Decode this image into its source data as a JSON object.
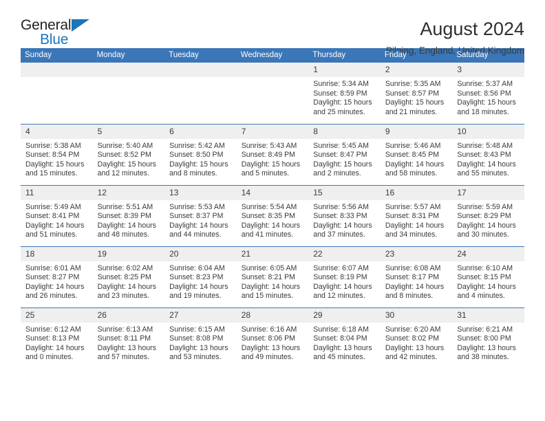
{
  "logo": {
    "primary_text": "General",
    "secondary_text": "Blue",
    "triangle_color": "#1b75bb",
    "primary_color": "#231f20",
    "secondary_color": "#1b75bb"
  },
  "header": {
    "title": "August 2024",
    "subtitle": "Pilning, England, United Kingdom"
  },
  "theme": {
    "header_blue": "#3a76b8",
    "daynum_gray": "#efefef",
    "text_color": "#3a3a3a"
  },
  "weekdays": [
    "Sunday",
    "Monday",
    "Tuesday",
    "Wednesday",
    "Thursday",
    "Friday",
    "Saturday"
  ],
  "weeks": [
    [
      {
        "day": "",
        "lines": []
      },
      {
        "day": "",
        "lines": []
      },
      {
        "day": "",
        "lines": []
      },
      {
        "day": "",
        "lines": []
      },
      {
        "day": "1",
        "lines": [
          "Sunrise: 5:34 AM",
          "Sunset: 8:59 PM",
          "Daylight: 15 hours",
          "and 25 minutes."
        ]
      },
      {
        "day": "2",
        "lines": [
          "Sunrise: 5:35 AM",
          "Sunset: 8:57 PM",
          "Daylight: 15 hours",
          "and 21 minutes."
        ]
      },
      {
        "day": "3",
        "lines": [
          "Sunrise: 5:37 AM",
          "Sunset: 8:56 PM",
          "Daylight: 15 hours",
          "and 18 minutes."
        ]
      }
    ],
    [
      {
        "day": "4",
        "lines": [
          "Sunrise: 5:38 AM",
          "Sunset: 8:54 PM",
          "Daylight: 15 hours",
          "and 15 minutes."
        ]
      },
      {
        "day": "5",
        "lines": [
          "Sunrise: 5:40 AM",
          "Sunset: 8:52 PM",
          "Daylight: 15 hours",
          "and 12 minutes."
        ]
      },
      {
        "day": "6",
        "lines": [
          "Sunrise: 5:42 AM",
          "Sunset: 8:50 PM",
          "Daylight: 15 hours",
          "and 8 minutes."
        ]
      },
      {
        "day": "7",
        "lines": [
          "Sunrise: 5:43 AM",
          "Sunset: 8:49 PM",
          "Daylight: 15 hours",
          "and 5 minutes."
        ]
      },
      {
        "day": "8",
        "lines": [
          "Sunrise: 5:45 AM",
          "Sunset: 8:47 PM",
          "Daylight: 15 hours",
          "and 2 minutes."
        ]
      },
      {
        "day": "9",
        "lines": [
          "Sunrise: 5:46 AM",
          "Sunset: 8:45 PM",
          "Daylight: 14 hours",
          "and 58 minutes."
        ]
      },
      {
        "day": "10",
        "lines": [
          "Sunrise: 5:48 AM",
          "Sunset: 8:43 PM",
          "Daylight: 14 hours",
          "and 55 minutes."
        ]
      }
    ],
    [
      {
        "day": "11",
        "lines": [
          "Sunrise: 5:49 AM",
          "Sunset: 8:41 PM",
          "Daylight: 14 hours",
          "and 51 minutes."
        ]
      },
      {
        "day": "12",
        "lines": [
          "Sunrise: 5:51 AM",
          "Sunset: 8:39 PM",
          "Daylight: 14 hours",
          "and 48 minutes."
        ]
      },
      {
        "day": "13",
        "lines": [
          "Sunrise: 5:53 AM",
          "Sunset: 8:37 PM",
          "Daylight: 14 hours",
          "and 44 minutes."
        ]
      },
      {
        "day": "14",
        "lines": [
          "Sunrise: 5:54 AM",
          "Sunset: 8:35 PM",
          "Daylight: 14 hours",
          "and 41 minutes."
        ]
      },
      {
        "day": "15",
        "lines": [
          "Sunrise: 5:56 AM",
          "Sunset: 8:33 PM",
          "Daylight: 14 hours",
          "and 37 minutes."
        ]
      },
      {
        "day": "16",
        "lines": [
          "Sunrise: 5:57 AM",
          "Sunset: 8:31 PM",
          "Daylight: 14 hours",
          "and 34 minutes."
        ]
      },
      {
        "day": "17",
        "lines": [
          "Sunrise: 5:59 AM",
          "Sunset: 8:29 PM",
          "Daylight: 14 hours",
          "and 30 minutes."
        ]
      }
    ],
    [
      {
        "day": "18",
        "lines": [
          "Sunrise: 6:01 AM",
          "Sunset: 8:27 PM",
          "Daylight: 14 hours",
          "and 26 minutes."
        ]
      },
      {
        "day": "19",
        "lines": [
          "Sunrise: 6:02 AM",
          "Sunset: 8:25 PM",
          "Daylight: 14 hours",
          "and 23 minutes."
        ]
      },
      {
        "day": "20",
        "lines": [
          "Sunrise: 6:04 AM",
          "Sunset: 8:23 PM",
          "Daylight: 14 hours",
          "and 19 minutes."
        ]
      },
      {
        "day": "21",
        "lines": [
          "Sunrise: 6:05 AM",
          "Sunset: 8:21 PM",
          "Daylight: 14 hours",
          "and 15 minutes."
        ]
      },
      {
        "day": "22",
        "lines": [
          "Sunrise: 6:07 AM",
          "Sunset: 8:19 PM",
          "Daylight: 14 hours",
          "and 12 minutes."
        ]
      },
      {
        "day": "23",
        "lines": [
          "Sunrise: 6:08 AM",
          "Sunset: 8:17 PM",
          "Daylight: 14 hours",
          "and 8 minutes."
        ]
      },
      {
        "day": "24",
        "lines": [
          "Sunrise: 6:10 AM",
          "Sunset: 8:15 PM",
          "Daylight: 14 hours",
          "and 4 minutes."
        ]
      }
    ],
    [
      {
        "day": "25",
        "lines": [
          "Sunrise: 6:12 AM",
          "Sunset: 8:13 PM",
          "Daylight: 14 hours",
          "and 0 minutes."
        ]
      },
      {
        "day": "26",
        "lines": [
          "Sunrise: 6:13 AM",
          "Sunset: 8:11 PM",
          "Daylight: 13 hours",
          "and 57 minutes."
        ]
      },
      {
        "day": "27",
        "lines": [
          "Sunrise: 6:15 AM",
          "Sunset: 8:08 PM",
          "Daylight: 13 hours",
          "and 53 minutes."
        ]
      },
      {
        "day": "28",
        "lines": [
          "Sunrise: 6:16 AM",
          "Sunset: 8:06 PM",
          "Daylight: 13 hours",
          "and 49 minutes."
        ]
      },
      {
        "day": "29",
        "lines": [
          "Sunrise: 6:18 AM",
          "Sunset: 8:04 PM",
          "Daylight: 13 hours",
          "and 45 minutes."
        ]
      },
      {
        "day": "30",
        "lines": [
          "Sunrise: 6:20 AM",
          "Sunset: 8:02 PM",
          "Daylight: 13 hours",
          "and 42 minutes."
        ]
      },
      {
        "day": "31",
        "lines": [
          "Sunrise: 6:21 AM",
          "Sunset: 8:00 PM",
          "Daylight: 13 hours",
          "and 38 minutes."
        ]
      }
    ]
  ]
}
